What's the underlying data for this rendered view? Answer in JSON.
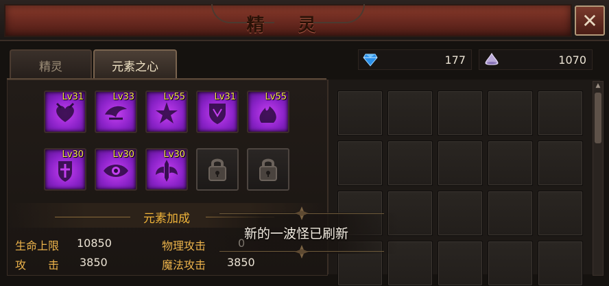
{
  "window": {
    "title": "精 灵",
    "close_icon": "close-icon"
  },
  "tabs": [
    {
      "label": "精灵",
      "active": false
    },
    {
      "label": "元素之心",
      "active": true
    }
  ],
  "currency": {
    "diamond": {
      "icon": "diamond-icon",
      "amount": "177"
    },
    "crystal": {
      "icon": "crystal-icon",
      "amount": "1070"
    }
  },
  "element_slots": [
    {
      "level": "Lv31",
      "icon": "heart-emblem-icon",
      "locked": false
    },
    {
      "level": "Lv33",
      "icon": "wing-emblem-icon",
      "locked": false
    },
    {
      "level": "Lv55",
      "icon": "star-emblem-icon",
      "locked": false
    },
    {
      "level": "Lv31",
      "icon": "shield-emblem-icon",
      "locked": false
    },
    {
      "level": "Lv55",
      "icon": "flame-emblem-icon",
      "locked": false
    },
    {
      "level": "Lv30",
      "icon": "cross-shield-emblem-icon",
      "locked": false
    },
    {
      "level": "Lv30",
      "icon": "eye-emblem-icon",
      "locked": false
    },
    {
      "level": "Lv30",
      "icon": "sword-wing-emblem-icon",
      "locked": false
    },
    {
      "level": "",
      "icon": "padlock-icon",
      "locked": true
    },
    {
      "level": "",
      "icon": "padlock-icon",
      "locked": true
    }
  ],
  "bonus": {
    "title": "元素加成",
    "stats": [
      {
        "label": "生命上限",
        "value": "10850"
      },
      {
        "label": "物理攻击",
        "value": "0"
      },
      {
        "label": "攻　　击",
        "value": "3850"
      },
      {
        "label": "魔法攻击",
        "value": "3850"
      }
    ]
  },
  "toast": {
    "message": "新的一波怪已刷新"
  },
  "colors": {
    "title_plaque": "#7a3326",
    "accent_gold": "#f0b43a",
    "level_yellow": "#f5e64a",
    "emblem_purple": "#a52fe0"
  }
}
